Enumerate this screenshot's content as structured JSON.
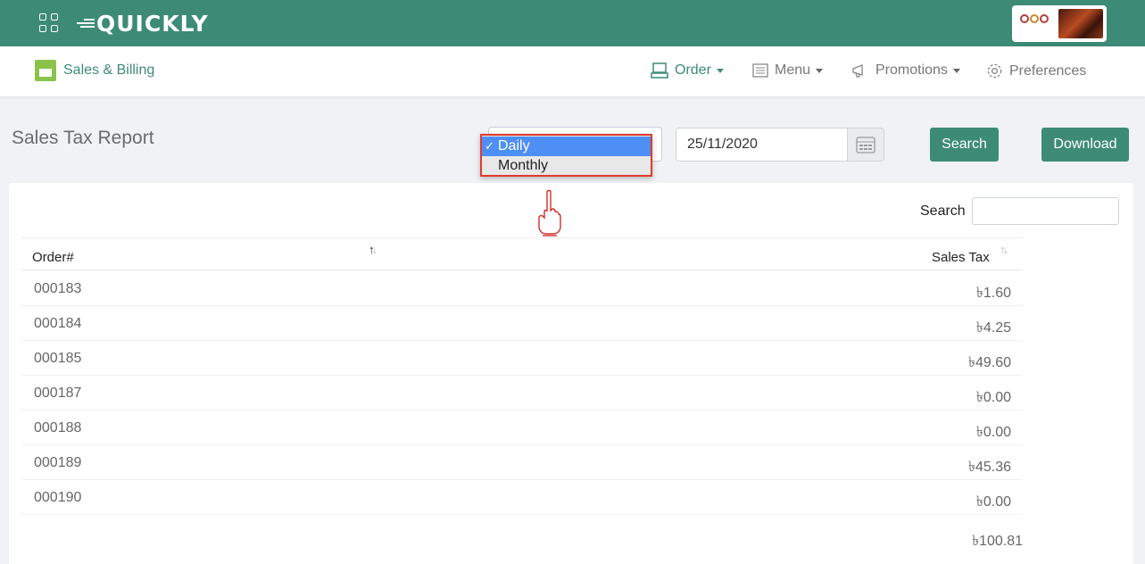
{
  "app": {
    "logo_text": "QUICKLY"
  },
  "nav": {
    "module_label": "Sales & Billing",
    "items": [
      {
        "label": "Order",
        "icon": "register-icon",
        "active": true
      },
      {
        "label": "Menu",
        "icon": "menu-list-icon"
      },
      {
        "label": "Promotions",
        "icon": "megaphone-icon"
      },
      {
        "label": "Preferences",
        "icon": "gear-icon"
      }
    ]
  },
  "page": {
    "title": "Sales Tax Report",
    "period_options": [
      "Daily",
      "Monthly"
    ],
    "period_selected": "Daily",
    "date_value": "25/11/2020",
    "search_button": "Search",
    "download_button": "Download"
  },
  "table": {
    "search_label": "Search",
    "columns": [
      "Order#",
      "Sales Tax"
    ],
    "rows": [
      {
        "order": "000183",
        "tax": "৳1.60"
      },
      {
        "order": "000184",
        "tax": "৳4.25"
      },
      {
        "order": "000185",
        "tax": "৳49.60"
      },
      {
        "order": "000187",
        "tax": "৳0.00"
      },
      {
        "order": "000188",
        "tax": "৳0.00"
      },
      {
        "order": "000189",
        "tax": "৳45.36"
      },
      {
        "order": "000190",
        "tax": "৳0.00"
      }
    ],
    "total": "৳100.81"
  },
  "colors": {
    "primary": "#3d8b77",
    "highlight": "#e03a2e",
    "selected_option": "#4e8ff5"
  }
}
